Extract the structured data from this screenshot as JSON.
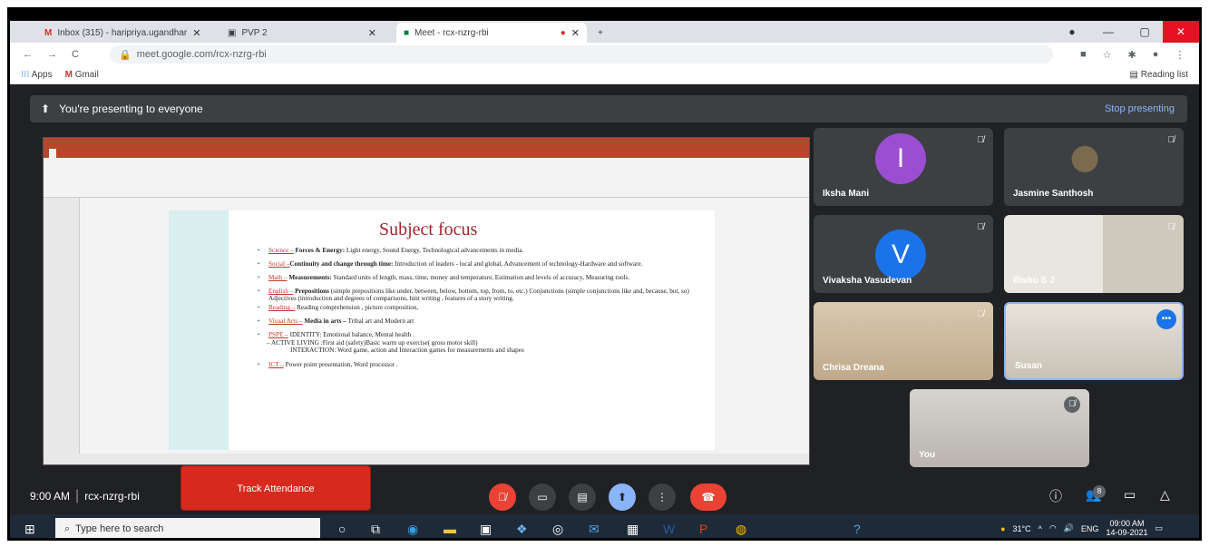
{
  "browser": {
    "tabs": [
      {
        "label": "Inbox (315) - haripriya.ugandhar"
      },
      {
        "label": "PVP 2"
      },
      {
        "label": "Meet - rcx-nzrg-rbi"
      }
    ],
    "new_tab": "+",
    "url": "meet.google.com/rcx-nzrg-rbi",
    "bookmarks": [
      "Apps",
      "Gmail"
    ],
    "reading_list": "Reading list"
  },
  "banner": {
    "text": "You're presenting to everyone",
    "stop": "Stop presenting"
  },
  "slide": {
    "title": "Subject focus",
    "items": [
      {
        "label": "Science –",
        "bold": "Forces & Energy:",
        "text": " Light energy, Sound Energy, Technological advancements in media."
      },
      {
        "label": "Social –",
        "bold": "Continuity and change through time:",
        "text": " Introduction of leaders - local and global, Advancement of technology-Hardware and software."
      },
      {
        "label": "Math –",
        "bold": "Measurements:",
        "text": " Standard units of length, mass, time, money and temperature, Estimation and levels of accuracy, Measuring tools."
      },
      {
        "label": "English –",
        "bold": "Prepositions",
        "text": " (simple prepositions like under, between, below, bottom, top, from, to, etc.) Conjunctions (simple conjunctions like and, because, but, so) Adjectives (introduction and degrees of comparisons, hint writing , features of a story writing."
      },
      {
        "label": "Reading –",
        "bold": "",
        "text": " Reading comprehension , picture composition,"
      },
      {
        "label": "Visual Arts –",
        "bold": "Media in arts –",
        "text": " Tribal art and Modern art"
      },
      {
        "label": "PSPE –",
        "bold": "",
        "text": "        IDENTITY: Emotional balance, Mental health ."
      },
      {
        "label": "ICT –",
        "bold": "",
        "text": " Power point presentation, Word processor ."
      }
    ],
    "pspe_sub1": "ACTIVE LIVING :First aid (safety)Basic warm up exercise( gross motor skill)",
    "pspe_sub2": "INTERACTION: Word game, action  and Interaction games for measurements and shapes"
  },
  "participants": [
    {
      "name": "Iksha Mani",
      "initial": "I",
      "color": "#9c4ed1"
    },
    {
      "name": "Jasmine Santhosh"
    },
    {
      "name": "Vivaksha Vasudevan",
      "initial": "V",
      "color": "#1a73e8"
    },
    {
      "name": "Rishu S J"
    },
    {
      "name": "Chrisa Dreana"
    },
    {
      "name": "Susan"
    },
    {
      "name": "You"
    }
  ],
  "meet": {
    "time": "9:00 AM",
    "code": "rcx-nzrg-rbi",
    "track_attendance": "Track Attendance",
    "people_count": "8"
  },
  "taskbar": {
    "search_placeholder": "Type here to search",
    "weather": "31°C",
    "lang": "ENG",
    "clock_time": "09:00 AM",
    "clock_date": "14-09-2021"
  }
}
